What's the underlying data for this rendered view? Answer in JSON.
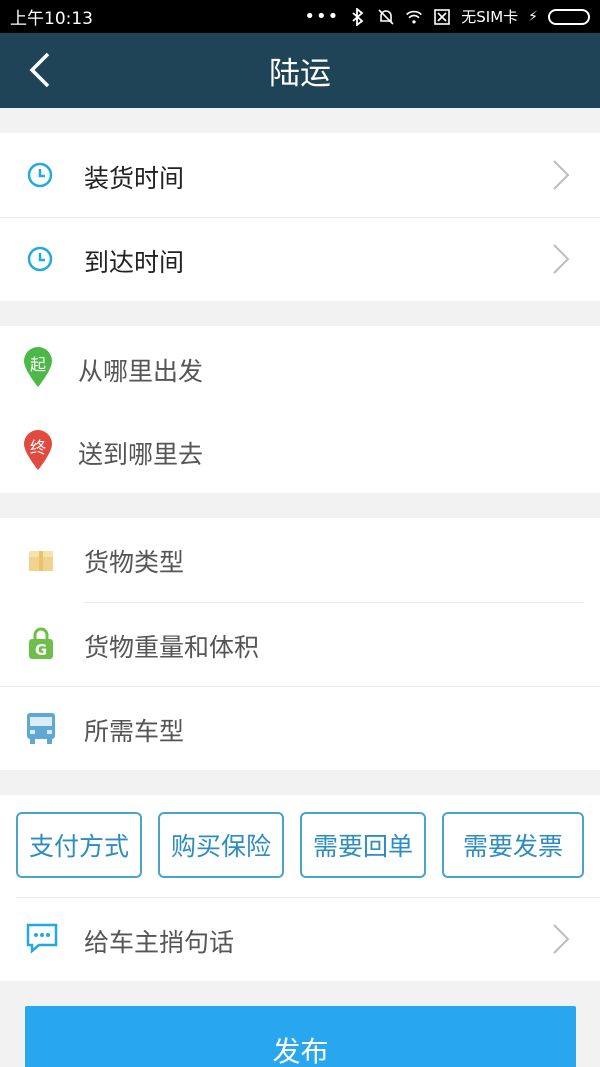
{
  "status_bar": {
    "time": "上午10:13",
    "carrier": "无SIM卡"
  },
  "nav": {
    "title": "陆运",
    "bg_color": "#1f4457"
  },
  "time_section": {
    "items": [
      {
        "label": "装货时间",
        "icon": "clock-icon"
      },
      {
        "label": "到达时间",
        "icon": "clock-icon"
      }
    ]
  },
  "route_section": {
    "start_badge": "起",
    "end_badge": "终",
    "items": [
      {
        "label": "从哪里出发",
        "icon": "start-pin-icon",
        "color": "#4cb848"
      },
      {
        "label": "送到哪里去",
        "icon": "end-pin-icon",
        "color": "#e04a3f"
      }
    ]
  },
  "cargo_section": {
    "weight_badge": "G",
    "items": [
      {
        "label": "货物类型",
        "icon": "box-icon"
      },
      {
        "label": "货物重量和体积",
        "icon": "weight-icon"
      },
      {
        "label": "所需车型",
        "icon": "truck-icon"
      }
    ]
  },
  "options": {
    "chips": [
      "支付方式",
      "购买保险",
      "需要回单",
      "需要发票"
    ],
    "message_label": "给车主捎句话"
  },
  "publish_label": "发布",
  "accent_color": "#29a7ee"
}
